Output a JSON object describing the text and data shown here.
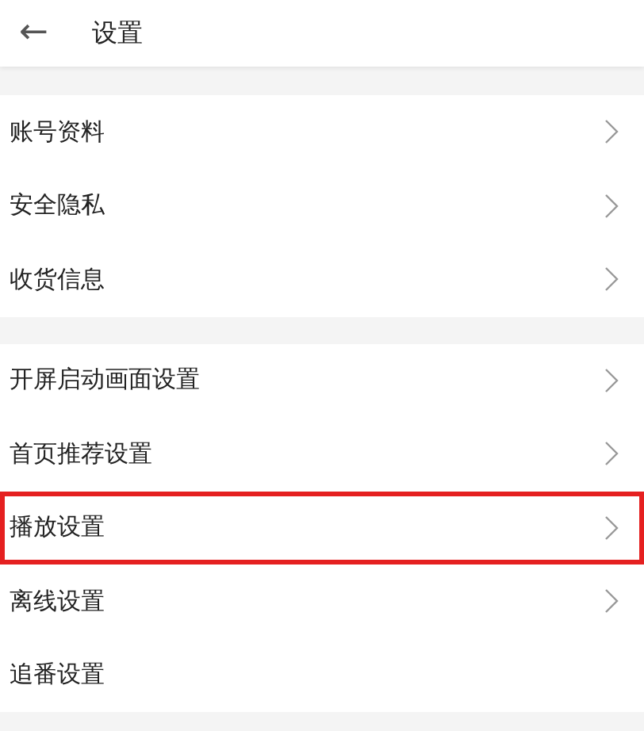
{
  "header": {
    "back": "←",
    "title": "设置"
  },
  "groups": [
    {
      "items": [
        {
          "label": "账号资料",
          "chevron": true,
          "highlighted": false
        },
        {
          "label": "安全隐私",
          "chevron": true,
          "highlighted": false
        },
        {
          "label": "收货信息",
          "chevron": true,
          "highlighted": false
        }
      ]
    },
    {
      "items": [
        {
          "label": "开屏启动画面设置",
          "chevron": true,
          "highlighted": false
        },
        {
          "label": "首页推荐设置",
          "chevron": true,
          "highlighted": false
        },
        {
          "label": "播放设置",
          "chevron": true,
          "highlighted": true
        },
        {
          "label": "离线设置",
          "chevron": true,
          "highlighted": false
        },
        {
          "label": "追番设置",
          "chevron": false,
          "highlighted": false
        }
      ]
    }
  ]
}
